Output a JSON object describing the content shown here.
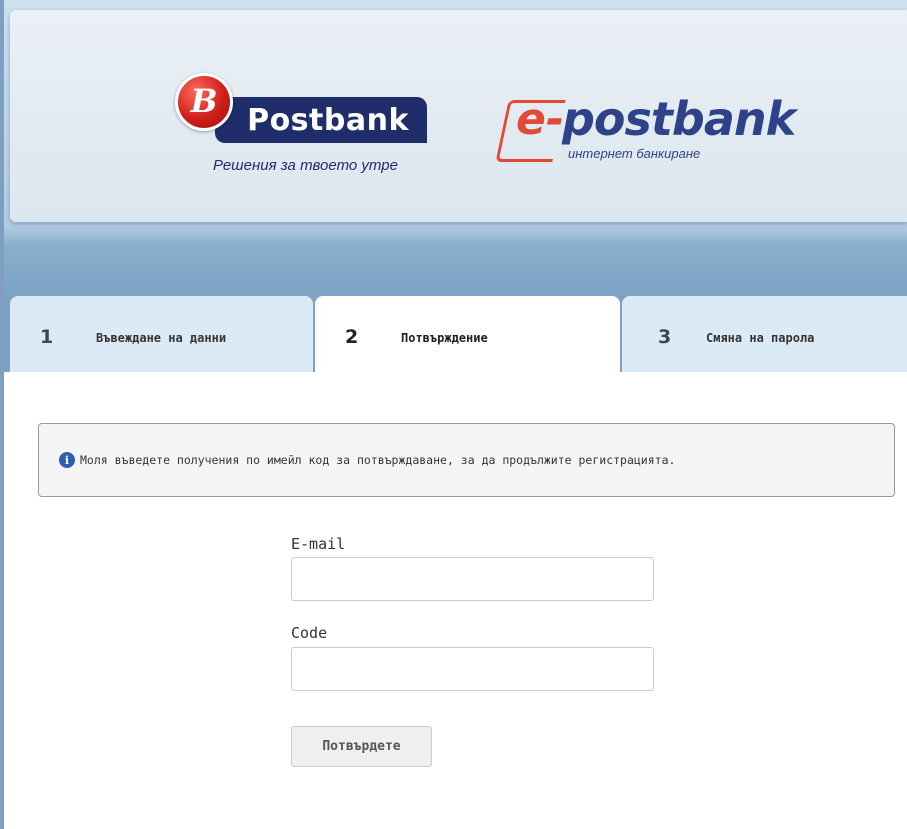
{
  "brand": {
    "postbank_badge_letter": "B",
    "postbank_name": "Postbank",
    "postbank_tagline": "Решения за твоето утре",
    "epostbank_prefix": "e-",
    "epostbank_name": "postbank",
    "epostbank_subtitle": "интернет банкиране"
  },
  "steps": [
    {
      "number": "1",
      "label": "Въвеждане на данни",
      "active": false
    },
    {
      "number": "2",
      "label": "Потвърждение",
      "active": true
    },
    {
      "number": "3",
      "label": "Смяна на парола",
      "active": false
    }
  ],
  "info": {
    "icon": "info-icon",
    "icon_glyph": "i",
    "message": "Моля въведете получения по имейл код за потвърждаване, за да продължите регистрацията."
  },
  "form": {
    "email_label": "E-mail",
    "email_value": "",
    "code_label": "Code",
    "code_value": "",
    "submit_label": "Потвърдете"
  },
  "colors": {
    "brand_navy": "#1f2d6b",
    "brand_red": "#e04a36",
    "info_blue": "#2d5fb3",
    "band_blue": "#7ca3c4"
  }
}
